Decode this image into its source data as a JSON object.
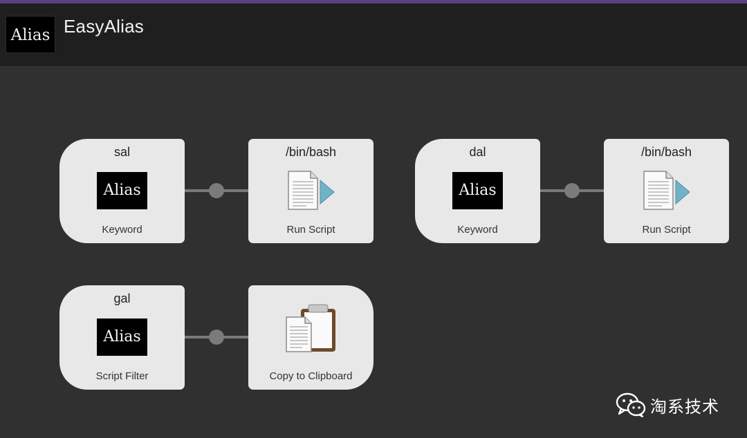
{
  "app": {
    "icon_text": "Alias",
    "title": "EasyAlias"
  },
  "colors": {
    "header_background": "#1f1f1f",
    "canvas_background": "#303030",
    "node_background": "#e8e8e8",
    "connector": "#7a7a7a",
    "accent": "#5a3f86",
    "script_arrow": "#6fb3c6",
    "clipboard_brown": "#6e4a2a"
  },
  "workflow": {
    "nodes": [
      {
        "id": "sal-keyword",
        "title": "sal",
        "icon": "alias-icon",
        "icon_text": "Alias",
        "subtitle": "Keyword"
      },
      {
        "id": "sal-run-script",
        "title": "/bin/bash",
        "icon": "script-document-icon",
        "subtitle": "Run Script"
      },
      {
        "id": "dal-keyword",
        "title": "dal",
        "icon": "alias-icon",
        "icon_text": "Alias",
        "subtitle": "Keyword"
      },
      {
        "id": "dal-run-script",
        "title": "/bin/bash",
        "icon": "script-document-icon",
        "subtitle": "Run Script"
      },
      {
        "id": "gal-script-filter",
        "title": "gal",
        "icon": "alias-icon",
        "icon_text": "Alias",
        "subtitle": "Script Filter"
      },
      {
        "id": "gal-clipboard",
        "title": "",
        "icon": "clipboard-icon",
        "subtitle": "Copy to Clipboard"
      }
    ],
    "connections": [
      {
        "from": "sal-keyword",
        "to": "sal-run-script"
      },
      {
        "from": "dal-keyword",
        "to": "dal-run-script"
      },
      {
        "from": "gal-script-filter",
        "to": "gal-clipboard"
      }
    ]
  },
  "watermark": {
    "icon": "wechat-icon",
    "text": "淘系技术"
  }
}
